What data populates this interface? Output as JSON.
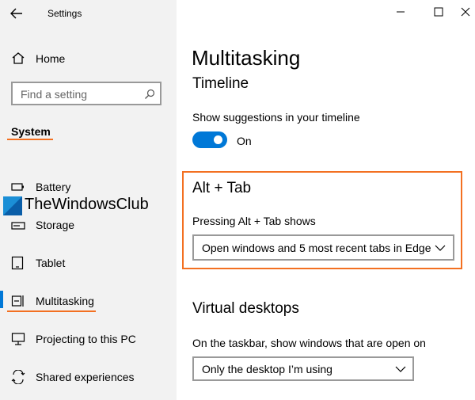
{
  "window": {
    "app_title": "Settings"
  },
  "sidebar": {
    "home_label": "Home",
    "search_placeholder": "Find a setting",
    "section_title": "System",
    "items": [
      {
        "label": "Battery",
        "icon": "battery-icon"
      },
      {
        "label": "Storage",
        "icon": "storage-icon"
      },
      {
        "label": "Tablet",
        "icon": "tablet-icon"
      },
      {
        "label": "Multitasking",
        "icon": "multitasking-icon",
        "active": true
      },
      {
        "label": "Projecting to this PC",
        "icon": "projecting-icon"
      },
      {
        "label": "Shared experiences",
        "icon": "shared-experiences-icon"
      }
    ]
  },
  "watermark": {
    "text": "TheWindowsClub"
  },
  "main": {
    "page_title": "Multitasking",
    "timeline": {
      "heading": "Timeline",
      "setting_label": "Show suggestions in your timeline",
      "toggle_state": "On"
    },
    "alt_tab": {
      "heading": "Alt + Tab",
      "label": "Pressing Alt + Tab shows",
      "selected_value": "Open windows and 5 most recent tabs in Edge"
    },
    "virtual_desktops": {
      "heading": "Virtual desktops",
      "label": "On the taskbar, show windows that are open on",
      "selected_value": "Only the desktop I’m using"
    }
  },
  "colors": {
    "accent": "#0078d7",
    "annotation_orange": "#f37021",
    "sidebar_bg": "#f2f2f2"
  }
}
